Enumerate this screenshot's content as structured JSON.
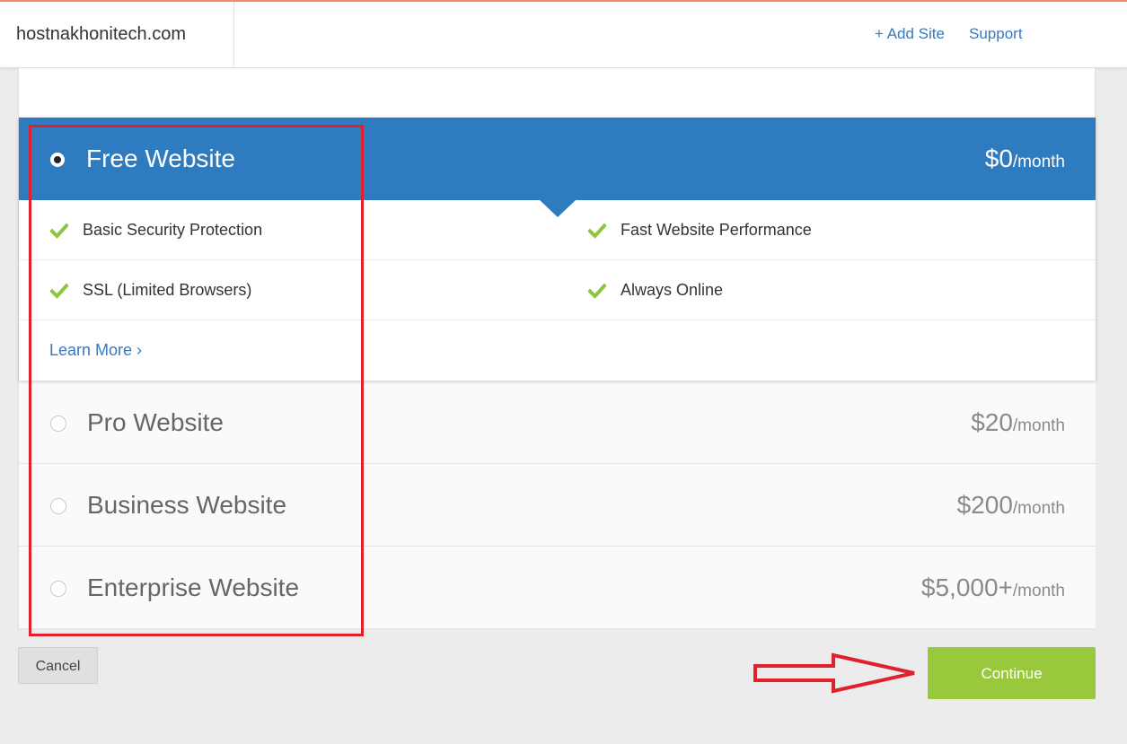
{
  "header": {
    "site_name": "hostnakhonitech.com",
    "add_site_label": "+ Add Site",
    "support_label": "Support"
  },
  "selected_plan": {
    "name": "Free Website",
    "price": "$0",
    "unit": "/month",
    "features_left": [
      "Basic Security Protection",
      "SSL (Limited Browsers)"
    ],
    "features_right": [
      "Fast Website Performance",
      "Always Online"
    ],
    "learn_more_label": "Learn More ›"
  },
  "plans": [
    {
      "name": "Pro Website",
      "price": "$20",
      "unit": "/month"
    },
    {
      "name": "Business Website",
      "price": "$200",
      "unit": "/month"
    },
    {
      "name": "Enterprise Website",
      "price": "$5,000+",
      "unit": "/month"
    }
  ],
  "footer": {
    "cancel_label": "Cancel",
    "continue_label": "Continue"
  },
  "colors": {
    "primary_blue": "#2f7bbf",
    "link_blue": "#3a78b9",
    "check_green": "#8cc63f",
    "continue_green": "#98c83b",
    "annotation_red": "#e0202a"
  },
  "icons": {
    "feature_check": "check-icon",
    "selected_radio": "radio-selected-icon",
    "empty_radio": "radio-empty-icon"
  }
}
